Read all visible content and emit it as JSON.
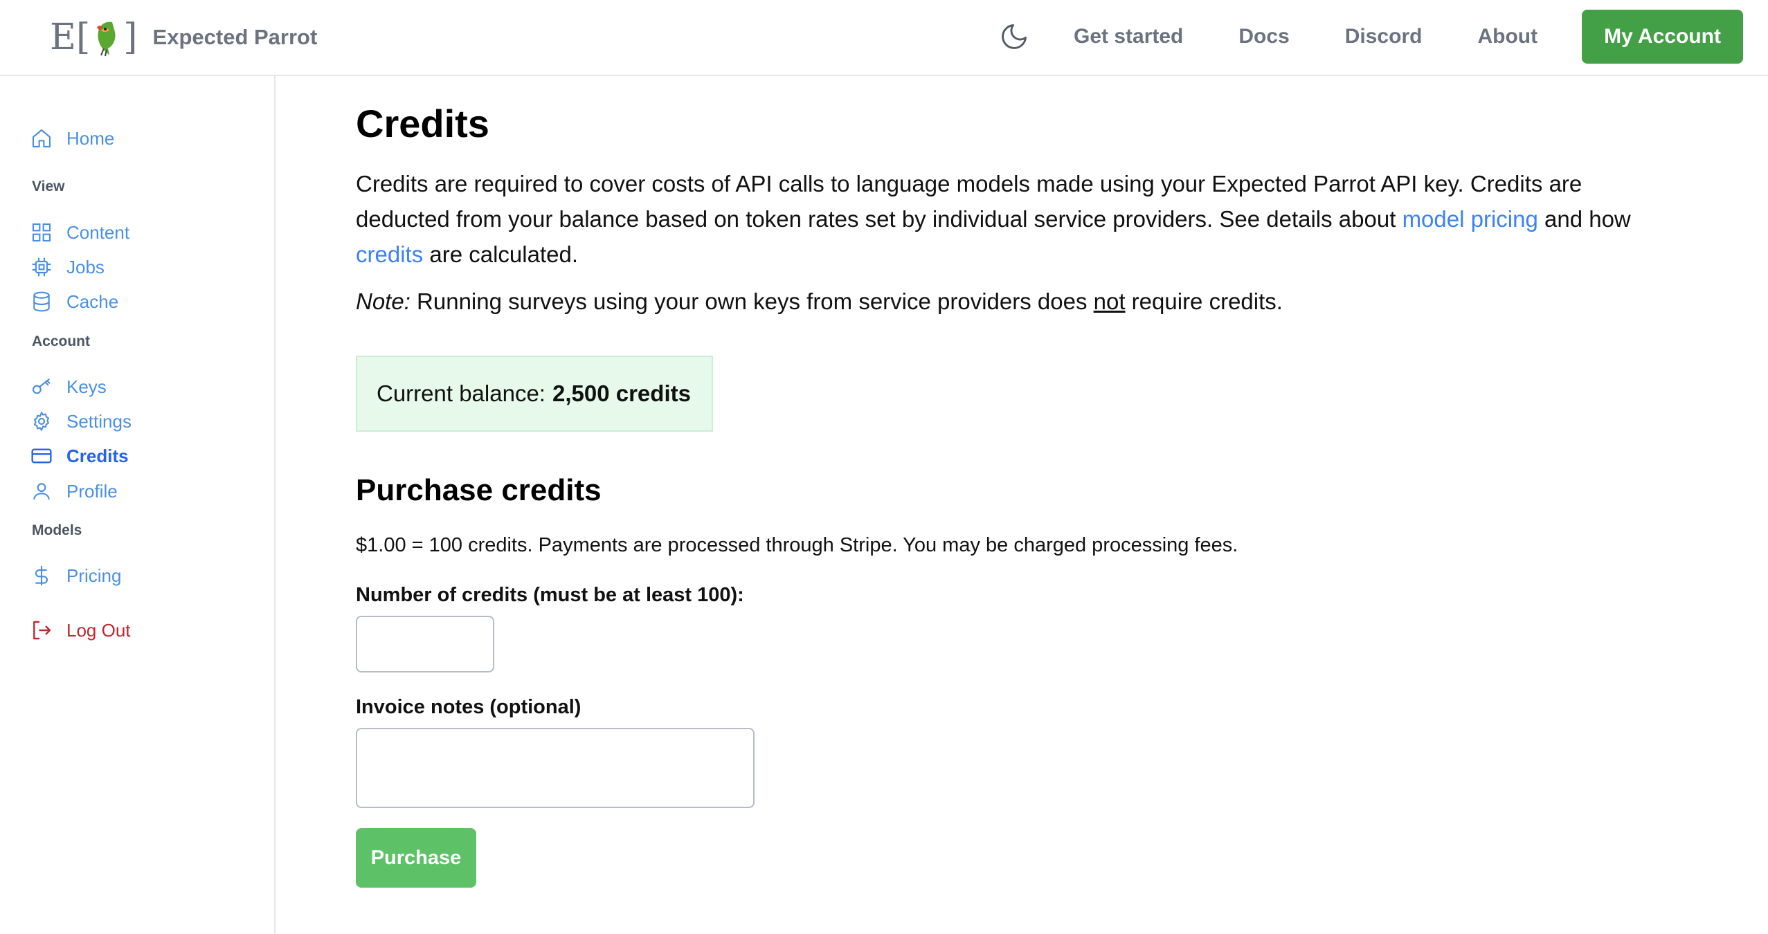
{
  "header": {
    "brand_name": "Expected Parrot",
    "logo_left": "E[",
    "logo_right": "]",
    "nav": {
      "get_started": "Get started",
      "docs": "Docs",
      "discord": "Discord",
      "about": "About"
    },
    "account_button": "My Account"
  },
  "sidebar": {
    "home": "Home",
    "view_heading": "View",
    "content": "Content",
    "jobs": "Jobs",
    "cache": "Cache",
    "account_heading": "Account",
    "keys": "Keys",
    "settings": "Settings",
    "credits": "Credits",
    "profile": "Profile",
    "models_heading": "Models",
    "pricing": "Pricing",
    "logout": "Log Out"
  },
  "main": {
    "title": "Credits",
    "intro_part1": "Credits are required to cover costs of API calls to language models made using your Expected Parrot API key. Credits are deducted from your balance based on token rates set by individual service providers. See details about ",
    "model_pricing_link": "model pricing",
    "intro_part2": " and how ",
    "credits_link": "credits",
    "intro_part3": " are calculated.",
    "note_label": "Note:",
    "note_part1": " Running surveys using your own keys from service providers does ",
    "note_not": "not",
    "note_part2": " require credits.",
    "balance_label": "Current balance:",
    "balance_value": "2,500 credits",
    "purchase_title": "Purchase credits",
    "rate_text": "$1.00 = 100 credits. Payments are processed through Stripe. You may be charged processing fees.",
    "credits_field_label": "Number of credits (must be at least 100):",
    "credits_field_value": "",
    "invoice_field_label": "Invoice notes (optional)",
    "invoice_field_value": "",
    "purchase_button": "Purchase"
  },
  "colors": {
    "accent_green": "#43a047",
    "purchase_green": "#5cc167",
    "link_blue": "#4a90e2",
    "active_blue": "#2563eb",
    "logout_red": "#c0262d",
    "balance_bg": "#e6f9ea"
  }
}
